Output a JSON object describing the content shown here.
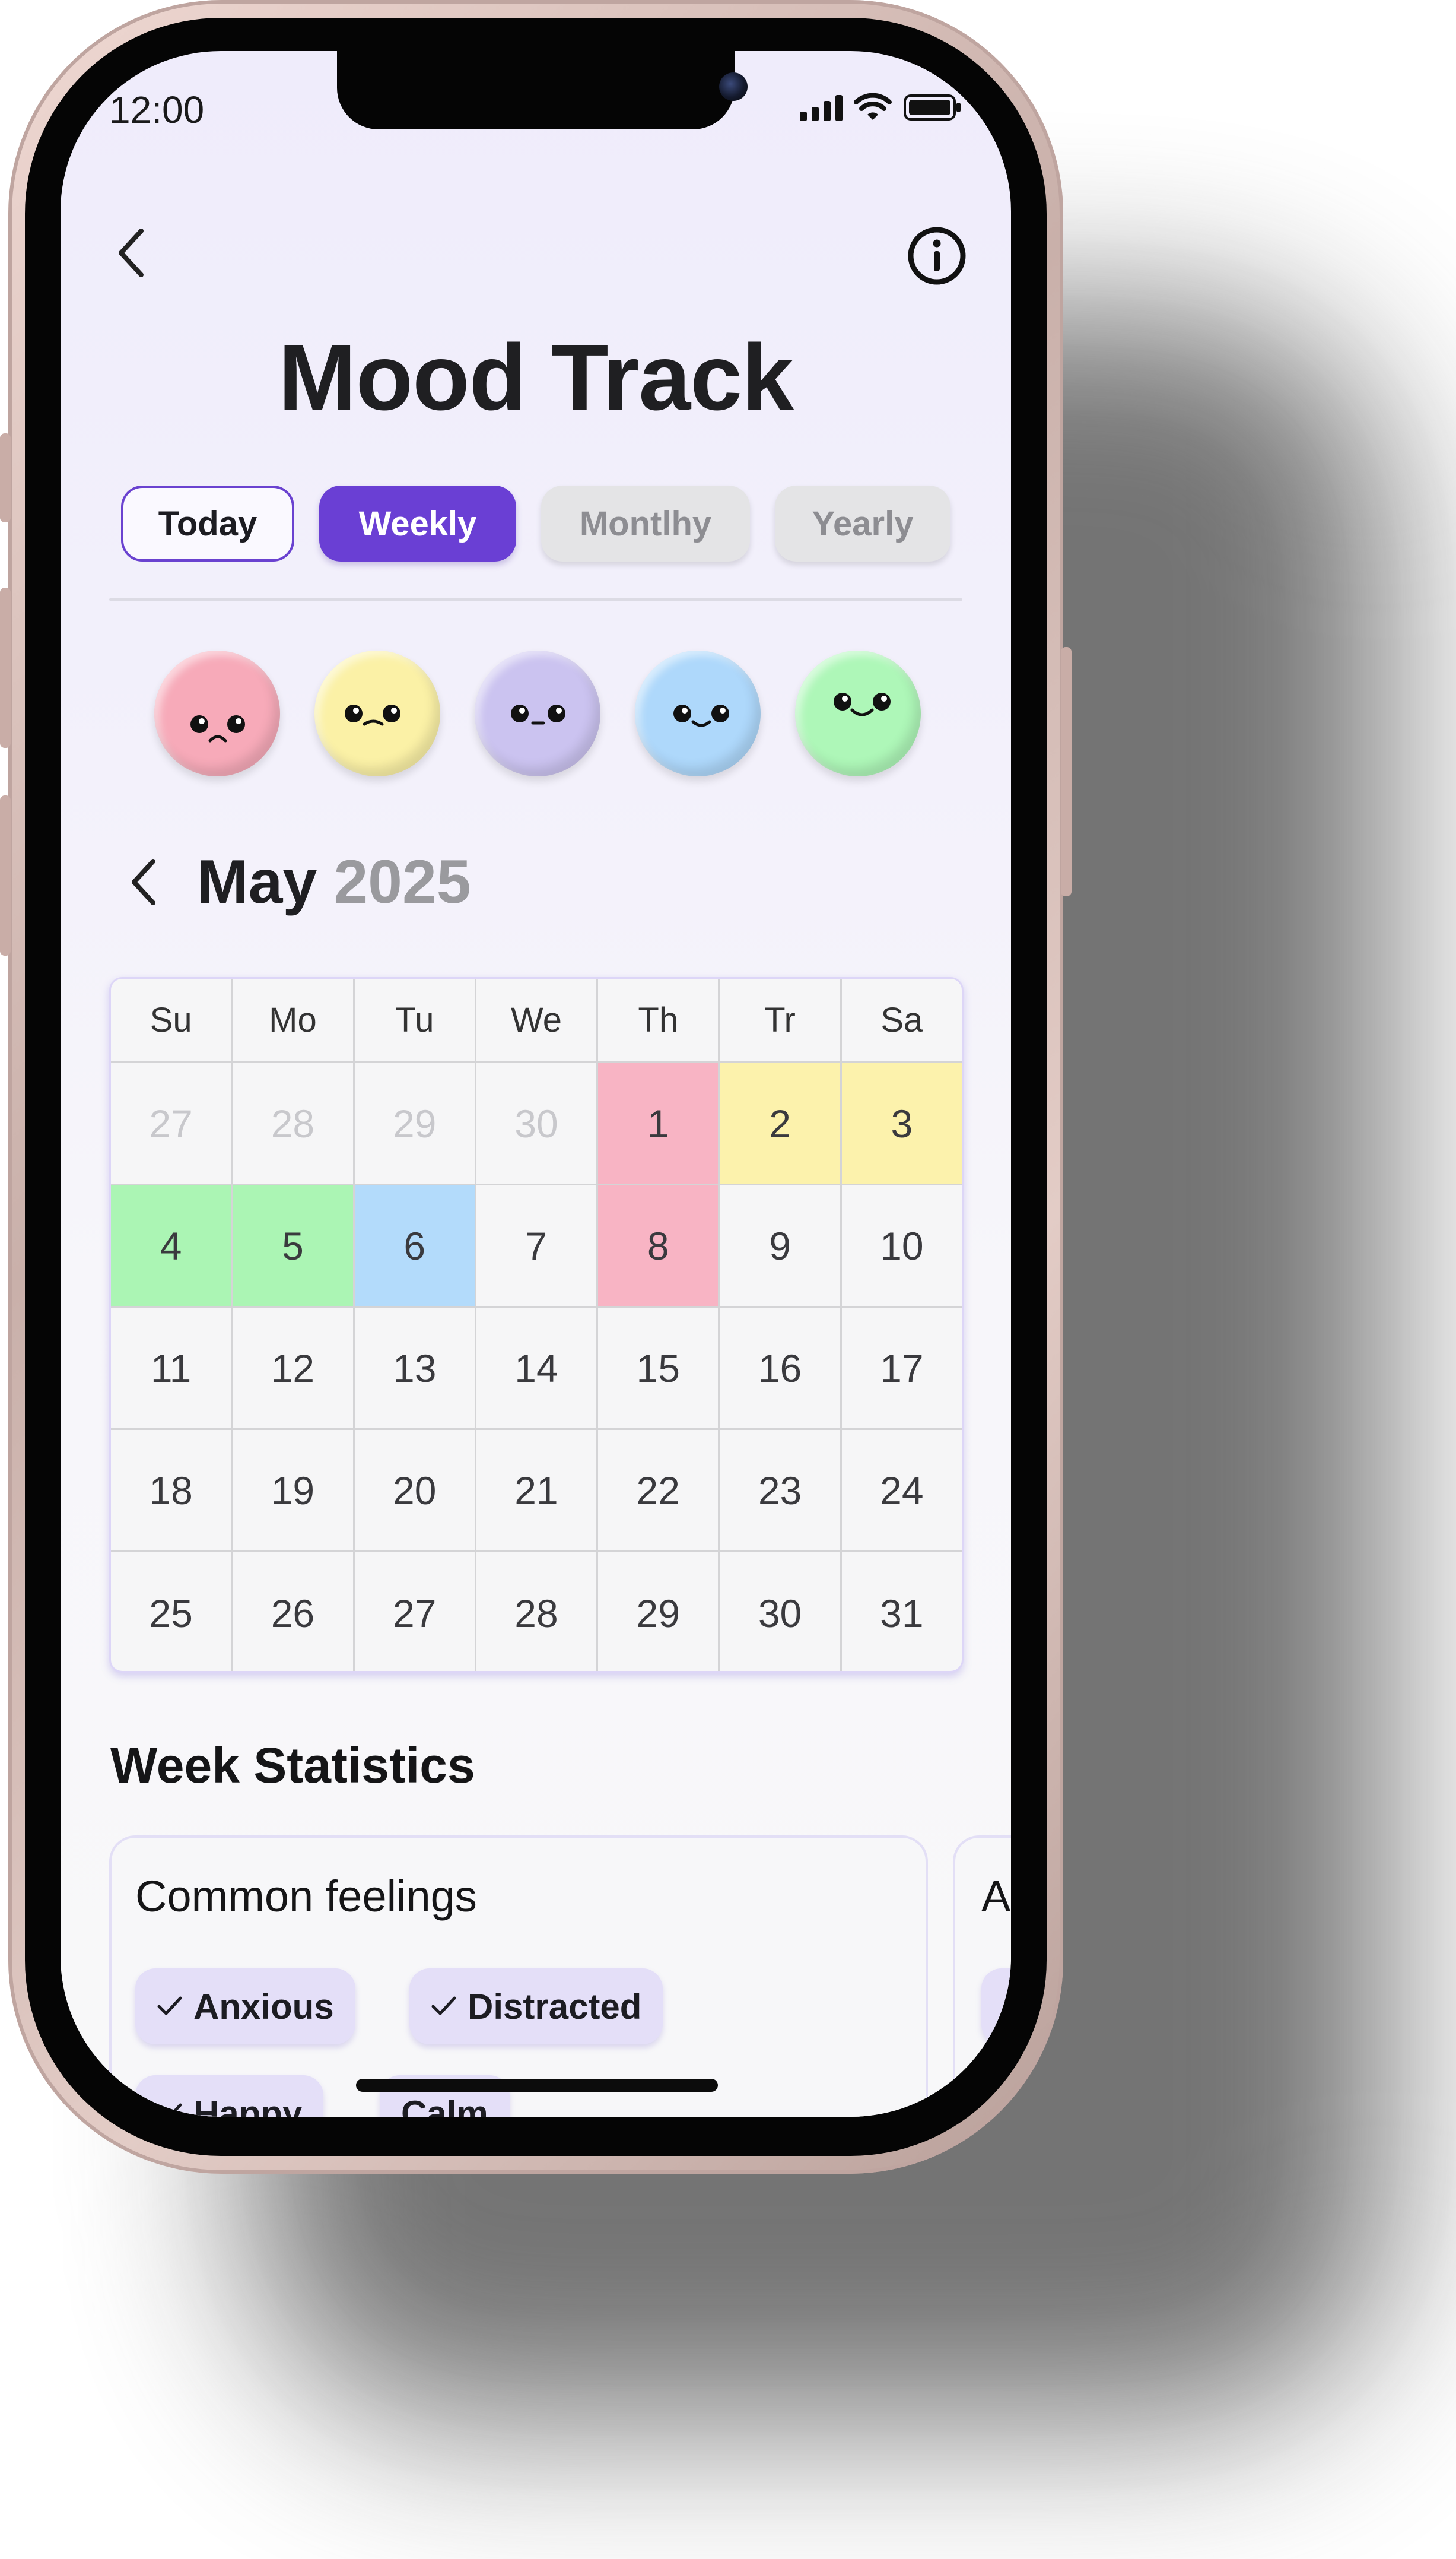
{
  "status": {
    "time": "12:00"
  },
  "header": {
    "title": "Mood Track"
  },
  "tabs": [
    {
      "label": "Today",
      "state": "outlined"
    },
    {
      "label": "Weekly",
      "state": "selected"
    },
    {
      "label": "Montlhy",
      "state": "disabled"
    },
    {
      "label": "Yearly",
      "state": "disabled"
    }
  ],
  "moods": [
    {
      "name": "sad",
      "color": "#f7aab9"
    },
    {
      "name": "meh",
      "color": "#fbf1a6"
    },
    {
      "name": "neutral",
      "color": "#cbc3f0"
    },
    {
      "name": "content",
      "color": "#aed8fb"
    },
    {
      "name": "happy",
      "color": "#aef7b8"
    }
  ],
  "calendar": {
    "month": "May",
    "year": "2025",
    "weekdays": [
      "Su",
      "Mo",
      "Tu",
      "We",
      "Th",
      "Tr",
      "Sa"
    ],
    "weeks": [
      [
        "27",
        "28",
        "29",
        "30",
        "1",
        "2",
        "3"
      ],
      [
        "4",
        "5",
        "6",
        "7",
        "8",
        "9",
        "10"
      ],
      [
        "11",
        "12",
        "13",
        "14",
        "15",
        "16",
        "17"
      ],
      [
        "18",
        "19",
        "20",
        "21",
        "22",
        "23",
        "24"
      ],
      [
        "25",
        "26",
        "27",
        "28",
        "29",
        "30",
        "31"
      ]
    ],
    "muted_days_in_first_week": 4,
    "day_colors": {
      "1": "#f8b4c4",
      "2": "#fcf2ac",
      "3": "#fcf2ac",
      "4": "#abf5b4",
      "5": "#abf5b4",
      "6": "#b3dbfb",
      "8": "#f8b4c4"
    }
  },
  "stats": {
    "title": "Week Statistics",
    "card1": {
      "title": "Common feelings",
      "chips": [
        "Anxious",
        "Distracted",
        "Happy",
        "Calm"
      ]
    },
    "card2": {
      "title": "A"
    }
  }
}
